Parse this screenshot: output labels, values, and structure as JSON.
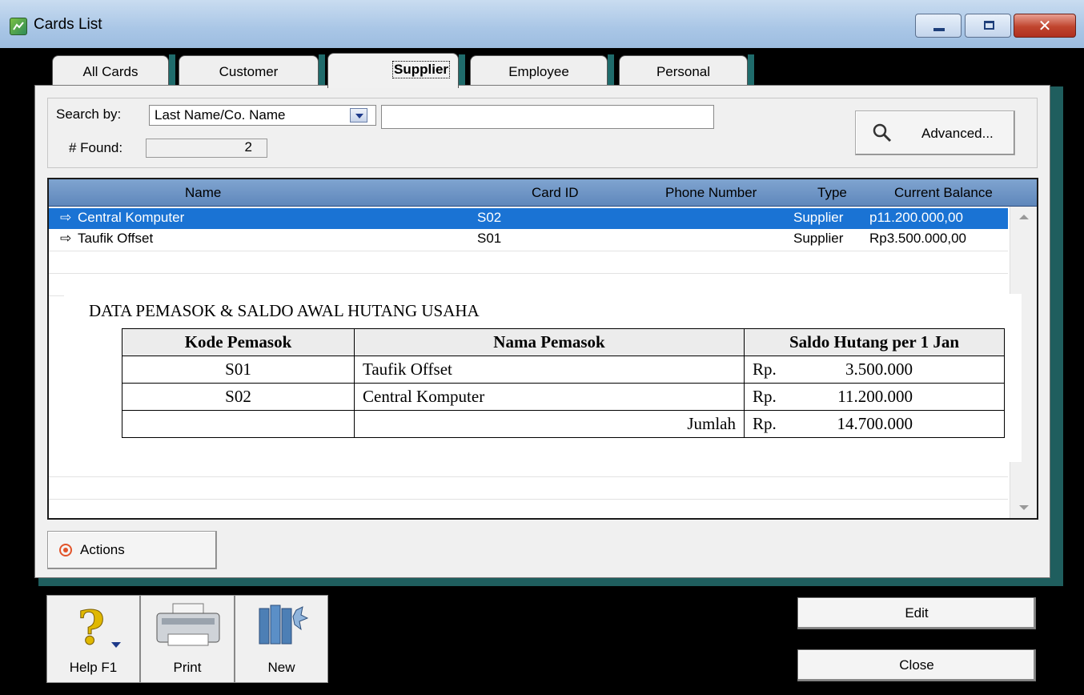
{
  "window": {
    "title": "Cards List"
  },
  "tabs": [
    {
      "label": "All Cards",
      "active": false
    },
    {
      "label": "Customer",
      "active": false
    },
    {
      "label": "Supplier",
      "active": true
    },
    {
      "label": "Employee",
      "active": false
    },
    {
      "label": "Personal",
      "active": false
    }
  ],
  "search": {
    "search_by_label": "Search by:",
    "search_by_value": "Last Name/Co. Name",
    "query_value": "",
    "found_label": "# Found:",
    "found_value": "2",
    "advanced_label": "Advanced..."
  },
  "list": {
    "columns": [
      "Name",
      "Card ID",
      "Phone Number",
      "Type",
      "Current Balance"
    ],
    "rows": [
      {
        "name": "Central Komputer",
        "card_id": "S02",
        "phone": "",
        "type": "Supplier",
        "balance": "p11.200.000,00",
        "selected": true
      },
      {
        "name": "Taufik Offset",
        "card_id": "S01",
        "phone": "",
        "type": "Supplier",
        "balance": "Rp3.500.000,00",
        "selected": false
      }
    ]
  },
  "overlay": {
    "title": "DATA PEMASOK & SALDO AWAL HUTANG USAHA",
    "headers": [
      "Kode Pemasok",
      "Nama Pemasok",
      "Saldo Hutang per 1 Jan"
    ],
    "rows": [
      {
        "code": "S01",
        "name": "Taufik Offset",
        "currency": "Rp.",
        "amount": "3.500.000"
      },
      {
        "code": "S02",
        "name": "Central Komputer",
        "currency": "Rp.",
        "amount": "11.200.000"
      }
    ],
    "total_label": "Jumlah",
    "total_currency": "Rp.",
    "total_amount": "14.700.000"
  },
  "actions_label": "Actions",
  "toolbar": {
    "help_label": "Help F1",
    "print_label": "Print",
    "new_label": "New"
  },
  "buttons": {
    "edit_label": "Edit",
    "close_label": "Close"
  },
  "colors": {
    "selection": "#1a73d4",
    "header": "#6f96c6",
    "frame": "#000000",
    "accent_shadow": "#1f5e5e"
  }
}
